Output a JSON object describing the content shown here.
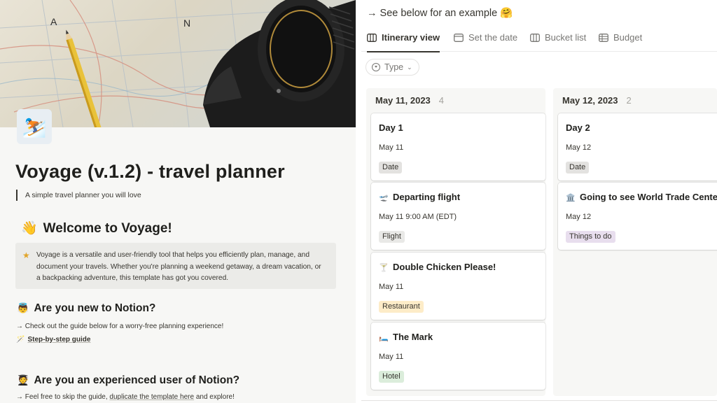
{
  "left": {
    "cover": {
      "letters": [
        "A",
        "N"
      ],
      "icon": "camera-map-cover-image"
    },
    "page_icon": "⛷️",
    "title": "Voyage (v.1.2) - travel planner",
    "subtitle": "A simple travel planner you will love",
    "welcome": {
      "emoji": "👋",
      "text": "Welcome to Voyage!"
    },
    "callout": {
      "icon": "★",
      "lines": [
        "Voyage is a versatile and user-friendly tool that helps you efficiently plan, manage, and",
        "document your travels. Whether you're planning a weekend getaway, a dream vacation, or",
        "a backpacking adventure, this template has got you covered."
      ]
    },
    "new_section": {
      "emoji": "👼",
      "heading": "Are you new to Notion?",
      "text": "→ Check out the guide below for a worry-free planning experience!",
      "guide_icon": "🪄",
      "guide_label": "Step-by-step guide"
    },
    "exp_section": {
      "emoji": "🧑‍🎓",
      "heading": "Are you an experienced user of Notion?",
      "prefix": "→ Feel free to skip the guide,",
      "link": "duplicate the template here",
      "suffix": "and explore!"
    }
  },
  "right": {
    "example_text": "→ See below for an example",
    "example_emoji": "🤗",
    "tabs": [
      {
        "label": "Itinerary view",
        "icon": "board-icon",
        "active": true
      },
      {
        "label": "Set the date",
        "icon": "calendar-icon",
        "active": false
      },
      {
        "label": "Bucket list",
        "icon": "board-icon",
        "active": false
      },
      {
        "label": "Budget",
        "icon": "table-icon",
        "active": false
      }
    ],
    "filter": {
      "label": "Type",
      "chevron": "⌄"
    },
    "columns": [
      {
        "date": "May 11, 2023",
        "count": "4",
        "cards": [
          {
            "emoji": "",
            "title": "Day 1",
            "date": "May 11",
            "tag": "Date",
            "tag_color": "#e3e2e0"
          },
          {
            "emoji": "🛫",
            "title": "Departing flight",
            "date": "May 11 9:00 AM (EDT)",
            "tag": "Flight",
            "tag_color": "#e9e9e7"
          },
          {
            "emoji": "🍸",
            "title": "Double Chicken Please!",
            "date": "May 11",
            "tag": "Restaurant",
            "tag_color": "#fdecc8"
          },
          {
            "emoji": "🛏️",
            "title": "The Mark",
            "date": "May 11",
            "tag": "Hotel",
            "tag_color": "#dbeddb"
          }
        ]
      },
      {
        "date": "May 12, 2023",
        "count": "2",
        "cards": [
          {
            "emoji": "",
            "title": "Day 2",
            "date": "May 12",
            "tag": "Date",
            "tag_color": "#e3e2e0"
          },
          {
            "emoji": "🏛️",
            "title": "Going to see World Trade Center",
            "date": "May 12",
            "tag": "Things to do",
            "tag_color": "#e8deee"
          }
        ]
      }
    ]
  }
}
